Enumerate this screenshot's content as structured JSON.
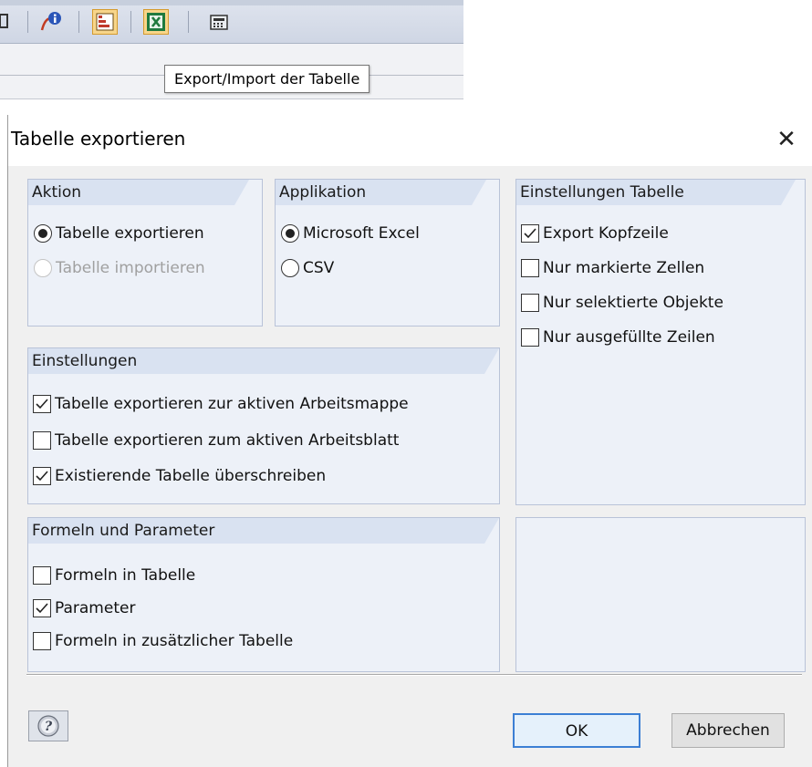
{
  "toolbar": {
    "tooltip": "Export/Import der Tabelle",
    "icons": [
      "partial-icon",
      "info-icon",
      "columns-icon",
      "excel-icon",
      "calculator-icon"
    ]
  },
  "dialog": {
    "title": "Tabelle exportieren",
    "close_glyph": "✕",
    "aktion": {
      "header": "Aktion",
      "options": [
        {
          "label": "Tabelle exportieren",
          "selected": true,
          "enabled": true
        },
        {
          "label": "Tabelle importieren",
          "selected": false,
          "enabled": false
        }
      ]
    },
    "applikation": {
      "header": "Applikation",
      "options": [
        {
          "label": "Microsoft Excel",
          "selected": true
        },
        {
          "label": "CSV",
          "selected": false
        }
      ]
    },
    "einstellungen_tabelle": {
      "header": "Einstellungen Tabelle",
      "options": [
        {
          "label": "Export Kopfzeile",
          "checked": true
        },
        {
          "label": "Nur markierte Zellen",
          "checked": false
        },
        {
          "label": "Nur selektierte Objekte",
          "checked": false
        },
        {
          "label": "Nur ausgefüllte Zeilen",
          "checked": false
        }
      ]
    },
    "einstellungen": {
      "header": "Einstellungen",
      "options": [
        {
          "label": "Tabelle exportieren zur aktiven Arbeitsmappe",
          "checked": true
        },
        {
          "label": "Tabelle exportieren zum aktiven Arbeitsblatt",
          "checked": false
        },
        {
          "label": "Existierende Tabelle überschreiben",
          "checked": true
        }
      ]
    },
    "formeln": {
      "header": "Formeln und Parameter",
      "options": [
        {
          "label": "Formeln in Tabelle",
          "checked": false
        },
        {
          "label": "Parameter",
          "checked": true
        },
        {
          "label": "Formeln in zusätzlicher Tabelle",
          "checked": false
        }
      ]
    },
    "buttons": {
      "ok": "OK",
      "cancel": "Abbrechen",
      "help_icon": "help-icon"
    }
  }
}
